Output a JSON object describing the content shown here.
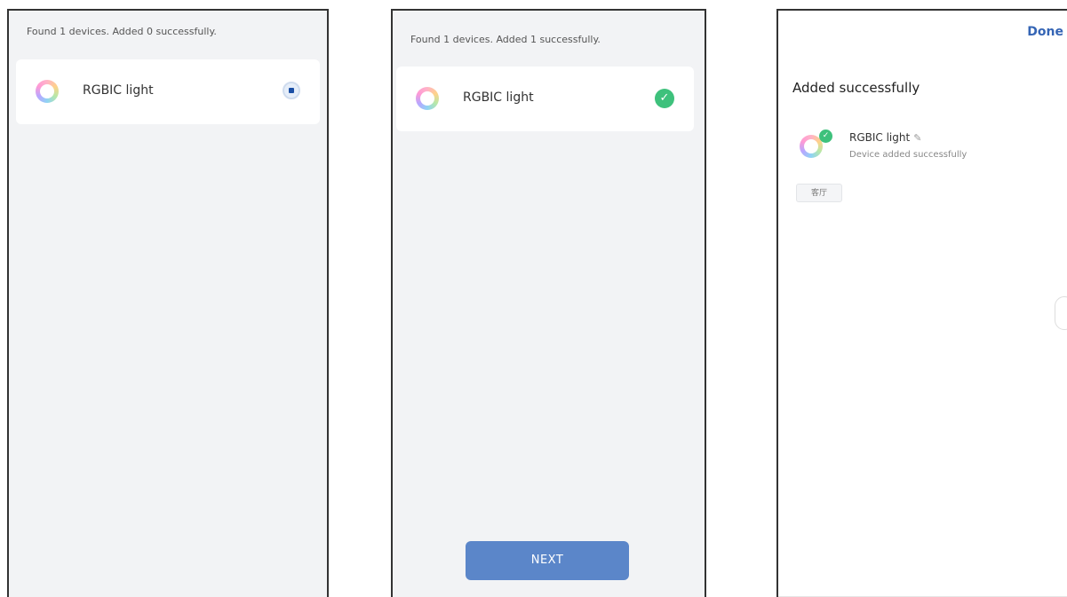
{
  "screen1": {
    "status": "Found 1 devices. Added 0 successfully.",
    "device_name": "RGBIC light"
  },
  "screen2": {
    "status": "Found 1 devices. Added 1 successfully.",
    "device_name": "RGBIC light",
    "next_label": "NEXT"
  },
  "screen3": {
    "done_label": "Done",
    "title": "Added successfully",
    "device_name": "RGBIC light",
    "device_status": "Device added successfully",
    "room_tag": "客厅"
  },
  "icons": {
    "check": "✓",
    "pencil": "✎"
  },
  "colors": {
    "accent_blue": "#5b86c9",
    "done_blue": "#3565b5",
    "success_green": "#3ec17c",
    "screen_bg": "#f2f3f5"
  }
}
